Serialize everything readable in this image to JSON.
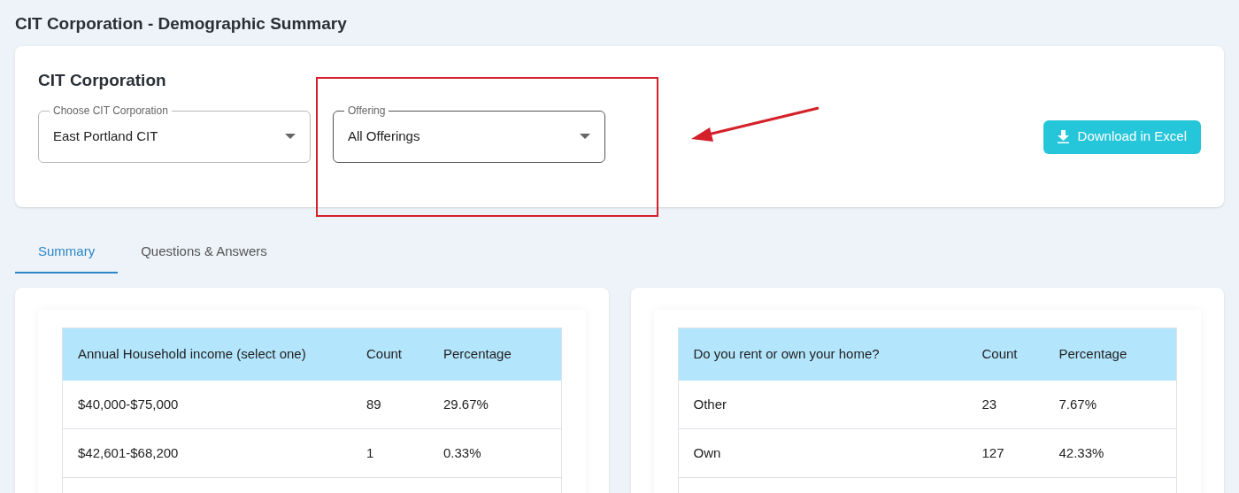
{
  "page_title": "CIT Corporation - Demographic Summary",
  "filter_card": {
    "title": "CIT Corporation",
    "selects": [
      {
        "label": "Choose CIT Corporation",
        "value": "East Portland CIT",
        "highlighted": false
      },
      {
        "label": "Offering",
        "value": "All Offerings",
        "highlighted": true
      }
    ],
    "download_button": "Download in Excel"
  },
  "tabs": [
    {
      "label": "Summary",
      "selected": true
    },
    {
      "label": "Questions & Answers",
      "selected": false
    }
  ],
  "tables": [
    {
      "columns": [
        "Annual Household income (select one)",
        "Count",
        "Percentage"
      ],
      "rows": [
        [
          "$40,000-$75,000",
          "89",
          "29.67%"
        ],
        [
          "$42,601-$68,200",
          "1",
          "0.33%"
        ]
      ]
    },
    {
      "columns": [
        "Do you rent or own your home?",
        "Count",
        "Percentage"
      ],
      "rows": [
        [
          "Other",
          "23",
          "7.67%"
        ],
        [
          "Own",
          "127",
          "42.33%"
        ]
      ]
    }
  ]
}
